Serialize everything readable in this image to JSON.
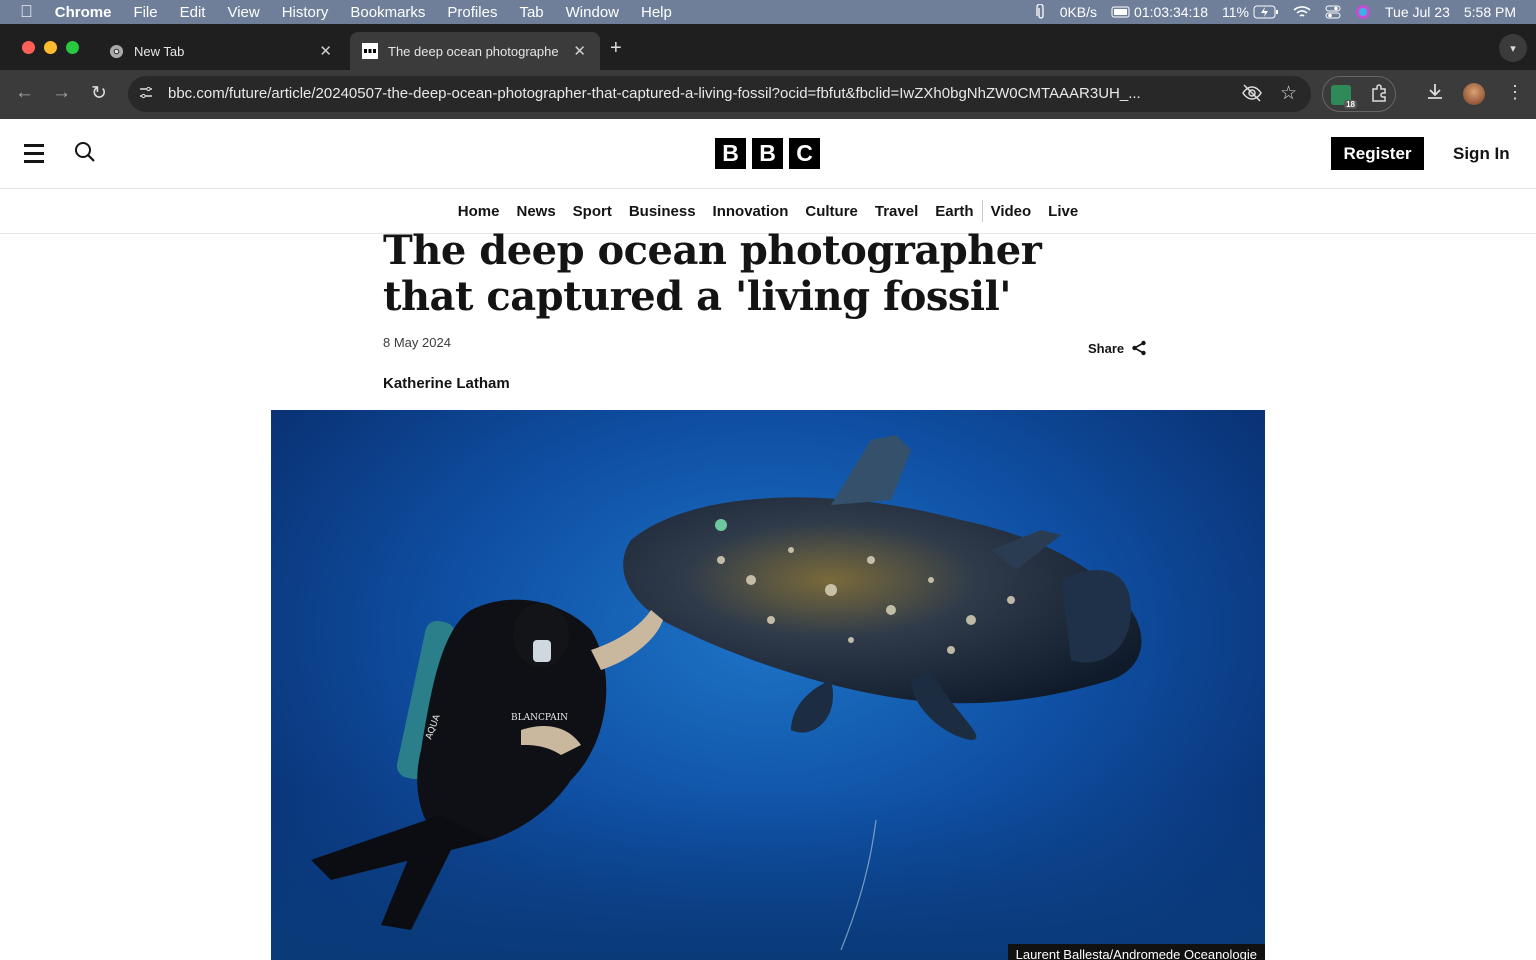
{
  "menubar": {
    "app": "Chrome",
    "items": [
      "File",
      "Edit",
      "View",
      "History",
      "Bookmarks",
      "Profiles",
      "Tab",
      "Window",
      "Help"
    ],
    "network": "0KB/s",
    "timer": "01:03:34:18",
    "battery": "11%",
    "date": "Tue Jul 23",
    "time": "5:58 PM"
  },
  "tabs": [
    {
      "title": "New Tab"
    },
    {
      "title": "The deep ocean photographe"
    }
  ],
  "toolbar": {
    "url": "bbc.com/future/article/20240507-the-deep-ocean-photographer-that-captured-a-living-fossil?ocid=fbfut&fbclid=IwZXh0bgNhZW0CMTAAAR3UH_...",
    "extension_badge": "18"
  },
  "bbc": {
    "logo": [
      "B",
      "B",
      "C"
    ],
    "register": "Register",
    "sign_in": "Sign In",
    "nav": [
      "Home",
      "News",
      "Sport",
      "Business",
      "Innovation",
      "Culture",
      "Travel",
      "Earth",
      "Video",
      "Live"
    ]
  },
  "article": {
    "title": "The deep ocean photographer that captured a 'living fossil'",
    "date": "8 May 2024",
    "share": "Share",
    "author": "Katherine Latham",
    "image_caption": "Laurent Ballesta/Andromede Oceanologie",
    "image_text_1": "BLANCPAIN",
    "image_text_2": "AQUA"
  },
  "colors": {
    "menubar": "#6f7f9a",
    "tabstrip": "#1f1f1f",
    "toolbar": "#3b3b3b",
    "ocean": "#0f4fa3"
  }
}
